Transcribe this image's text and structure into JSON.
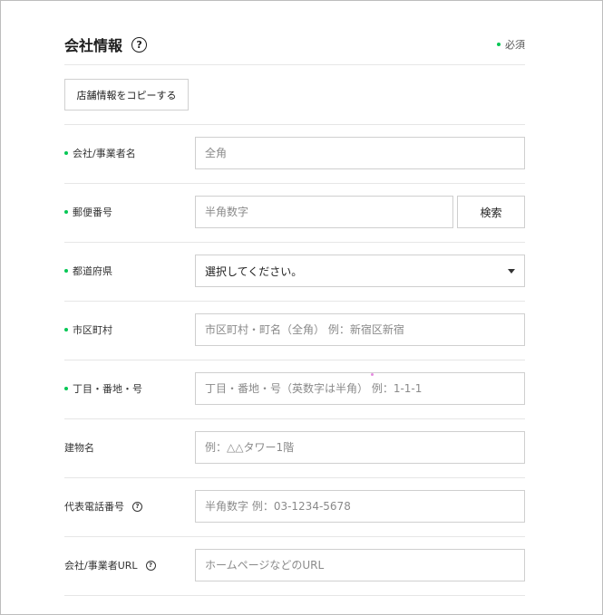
{
  "section": {
    "title": "会社情報",
    "help_glyph": "?",
    "required_legend": "必須",
    "required_color": "#06c755",
    "copy_button": "店舗情報をコピーする"
  },
  "fields": {
    "company_name": {
      "label": "会社/事業者名",
      "placeholder": "全角",
      "required": true
    },
    "postal_code": {
      "label": "郵便番号",
      "placeholder": "半角数字",
      "search_button": "検索",
      "required": true
    },
    "prefecture": {
      "label": "都道府県",
      "selected": "選択してください。",
      "required": true
    },
    "city": {
      "label": "市区町村",
      "placeholder": "市区町村・町名（全角） 例：新宿区新宿",
      "required": true
    },
    "street": {
      "label": "丁目・番地・号",
      "placeholder": "丁目・番地・号（英数字は半角） 例：1-1-1",
      "required": true
    },
    "building": {
      "label": "建物名",
      "placeholder": "例：△△タワー1階",
      "required": false
    },
    "phone": {
      "label": "代表電話番号",
      "placeholder": "半角数字 例：03-1234-5678",
      "required": false,
      "help_glyph": "?"
    },
    "url": {
      "label": "会社/事業者URL",
      "placeholder": "ホームページなどのURL",
      "required": false,
      "help_glyph": "?"
    }
  }
}
